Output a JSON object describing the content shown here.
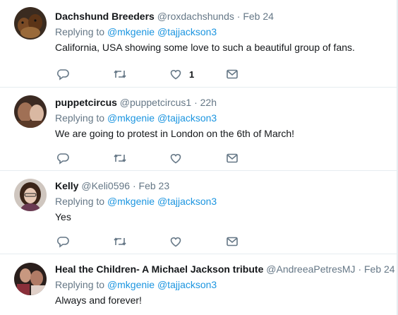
{
  "tweets": [
    {
      "name": "Dachshund Breeders",
      "handle": "@roxdachshunds",
      "separator": "·",
      "time": "Feb 24",
      "replying_prefix": "Replying to",
      "mentions": [
        "@mkgenie",
        "@tajjackson3"
      ],
      "text": "California, USA showing some love to such a beautiful group of fans.",
      "like_count": "1"
    },
    {
      "name": "puppetcircus",
      "handle": "@puppetcircus1",
      "separator": "·",
      "time": "22h",
      "replying_prefix": "Replying to",
      "mentions": [
        "@mkgenie",
        "@tajjackson3"
      ],
      "text": "We are going to protest in London on the 6th of March!",
      "like_count": ""
    },
    {
      "name": "Kelly",
      "handle": "@Keli0596",
      "separator": "·",
      "time": "Feb 23",
      "replying_prefix": "Replying to",
      "mentions": [
        "@mkgenie",
        "@tajjackson3"
      ],
      "text": "Yes",
      "like_count": ""
    },
    {
      "name": "Heal the Children- A Michael Jackson tribute",
      "handle": "@AndreeaPetresMJ",
      "separator": "·",
      "time": "Feb 24",
      "replying_prefix": "Replying to",
      "mentions": [
        "@mkgenie",
        "@tajjackson3"
      ],
      "text": "Always and forever!",
      "like_count": ""
    }
  ],
  "icons": {
    "reply": "reply-icon",
    "retweet": "retweet-icon",
    "like": "heart-icon",
    "message": "envelope-icon"
  },
  "colors": {
    "name": "#14171a",
    "secondary": "#657786",
    "mention": "#1b95e0",
    "divider": "#e6ecf0"
  }
}
